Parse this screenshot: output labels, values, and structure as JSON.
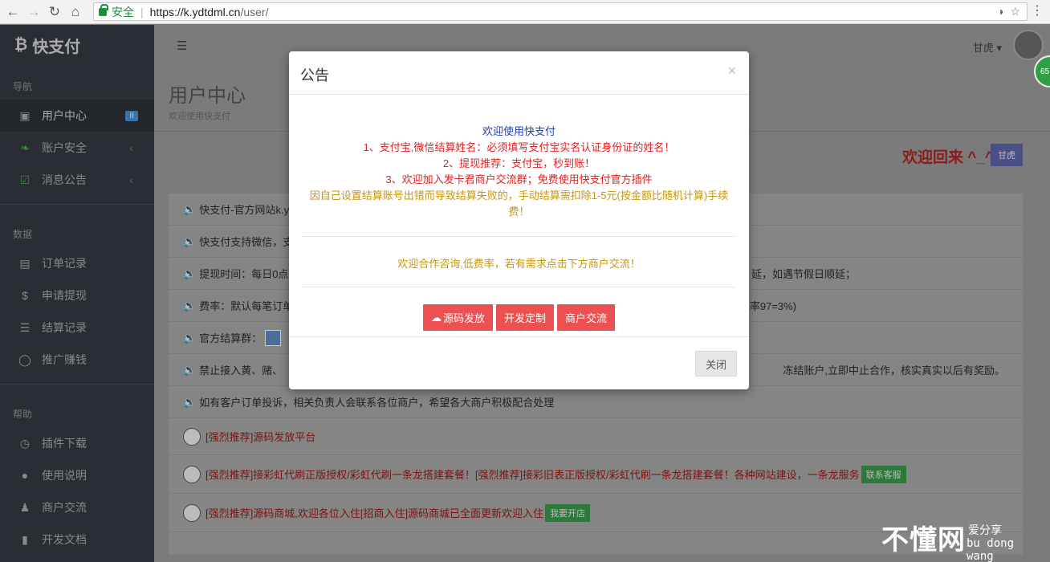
{
  "browser": {
    "secure_label": "安全",
    "url_host": "https://k.ydtdml.cn",
    "url_path": "/user/"
  },
  "sidebar": {
    "brand": "快支付",
    "sections": [
      {
        "title": "导航",
        "items": [
          {
            "label": "用户中心",
            "icon": "desktop-icon",
            "badge": "II"
          },
          {
            "label": "账户安全",
            "icon": "leaf-icon"
          },
          {
            "label": "消息公告",
            "icon": "check-mail-icon"
          }
        ]
      },
      {
        "title": "数据",
        "items": [
          {
            "label": "订单记录",
            "icon": "list-icon"
          },
          {
            "label": "申请提现",
            "icon": "dollar-icon"
          },
          {
            "label": "结算记录",
            "icon": "rows-icon"
          },
          {
            "label": "推广赚钱",
            "icon": "tag-icon"
          }
        ]
      },
      {
        "title": "帮助",
        "items": [
          {
            "label": "插件下载",
            "icon": "download-icon"
          },
          {
            "label": "使用说明",
            "icon": "info-icon"
          },
          {
            "label": "商户交流",
            "icon": "user-icon"
          },
          {
            "label": "开发文档",
            "icon": "book-icon"
          }
        ]
      }
    ]
  },
  "header": {
    "user": "甘虎 ▾",
    "badge_number": "65"
  },
  "page": {
    "title": "用户中心",
    "subtitle": "欢迎使用快支付",
    "welcome": "欢迎回来 ^_^",
    "exit": "甘虎"
  },
  "notices": [
    {
      "text": "快支付-官方网站k.yd"
    },
    {
      "text": "快支付支持微信，支"
    },
    {
      "text": "提现时间：每日0点",
      "tail": "延，如遇节假日顺延；"
    },
    {
      "text": "费率：默认每笔订单",
      "tail": "率97=3%)"
    },
    {
      "text": "官方结算群：",
      "qq": true
    },
    {
      "text": "禁止接入黄、赌、",
      "tail": "冻结账户,立即中止合作，核实真实以后有奖励。"
    },
    {
      "text": "如有客户订单投诉，相关负责人会联系各位商户，希望各大商户积极配合处理"
    },
    {
      "text": "[强烈推荐]源码发放平台",
      "red": true
    },
    {
      "text": "[强烈推荐]接彩虹代刷正版授权/彩虹代刷一条龙搭建套餐！[强烈推荐]接彩旧表正版授权/彩虹代刷一条龙搭建套餐！各种网站建设，一条龙服务",
      "red": true,
      "button": "联系客服"
    },
    {
      "text": "[强烈推荐]源码商城,欢迎各位入住[招商入住]源码商城已全面更新欢迎入住",
      "red": true,
      "button": "我要开店"
    }
  ],
  "modal": {
    "title": "公告",
    "close_x": "×",
    "line1": "欢迎使用快支付",
    "line2": "1、支付宝,微信结算姓名：必须填写支付宝实名认证身份证的姓名！",
    "line3": "2、提现推荐：支付宝，秒到账！",
    "line4": "3、欢迎加入发卡君商户交流群；免费使用快支付官方插件",
    "line5": "因自己设置结算账号出错而导致结算失败的，手动结算需扣除1-5元(按金额比随机计算)手续费！",
    "coop": "欢迎合作咨询,低费率，若有需求点击下方商户交流！",
    "buttons": [
      "源码发放",
      "开发定制",
      "商户交流"
    ],
    "close_button": "关闭"
  },
  "watermark": {
    "big": "不懂网",
    "small1": "爱分享",
    "small2": "bu dong wang"
  }
}
